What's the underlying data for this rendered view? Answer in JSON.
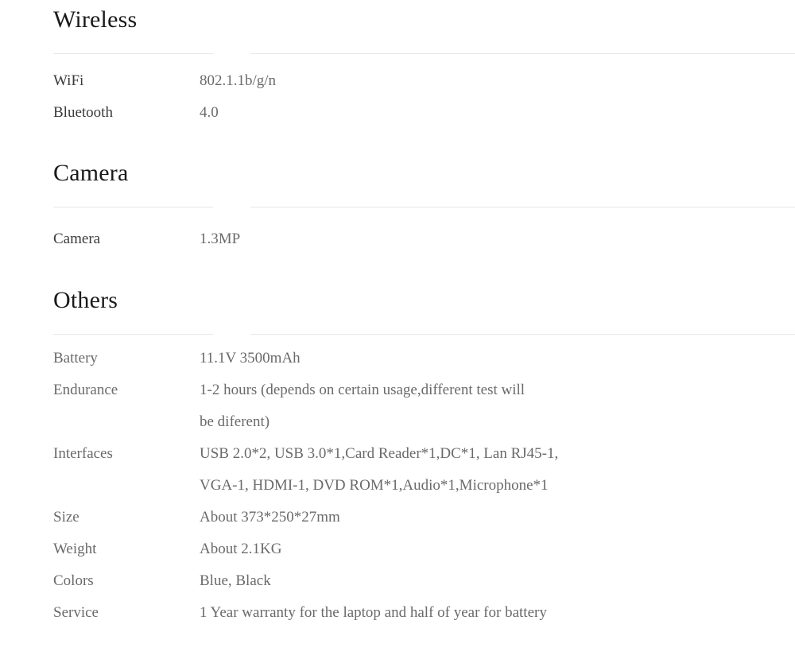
{
  "page": {
    "background_color": "#ffffff",
    "heading_color": "#1a1a1a",
    "label_color_dark": "#3a3a3a",
    "label_color_light": "#6a6a6a",
    "value_color": "#6a6a6a",
    "divider_color": "#e8e8e8"
  },
  "sections": [
    {
      "heading": "Wireless",
      "rows": [
        {
          "label": "WiFi",
          "lines": [
            "802.1.1b/g/n"
          ]
        },
        {
          "label": "Bluetooth",
          "lines": [
            "4.0"
          ]
        }
      ]
    },
    {
      "heading": "Camera",
      "rows": [
        {
          "label": "Camera",
          "lines": [
            "1.3MP"
          ]
        }
      ]
    },
    {
      "heading": "Others",
      "rows": [
        {
          "label": "Battery",
          "lines": [
            "11.1V 3500mAh"
          ]
        },
        {
          "label": "Endurance",
          "lines": [
            "1-2 hours (depends on certain usage,different test will",
            "be diferent)"
          ]
        },
        {
          "label": "Interfaces",
          "lines": [
            "USB 2.0*2, USB 3.0*1,Card Reader*1,DC*1, Lan RJ45-1,",
            "VGA-1, HDMI-1, DVD ROM*1,Audio*1,Microphone*1"
          ]
        },
        {
          "label": "Size",
          "lines": [
            "About 373*250*27mm"
          ]
        },
        {
          "label": "Weight",
          "lines": [
            "About 2.1KG"
          ]
        },
        {
          "label": "Colors",
          "lines": [
            "Blue, Black"
          ]
        },
        {
          "label": "Service",
          "lines": [
            "1 Year warranty for the laptop and half of year for battery"
          ]
        }
      ]
    }
  ]
}
